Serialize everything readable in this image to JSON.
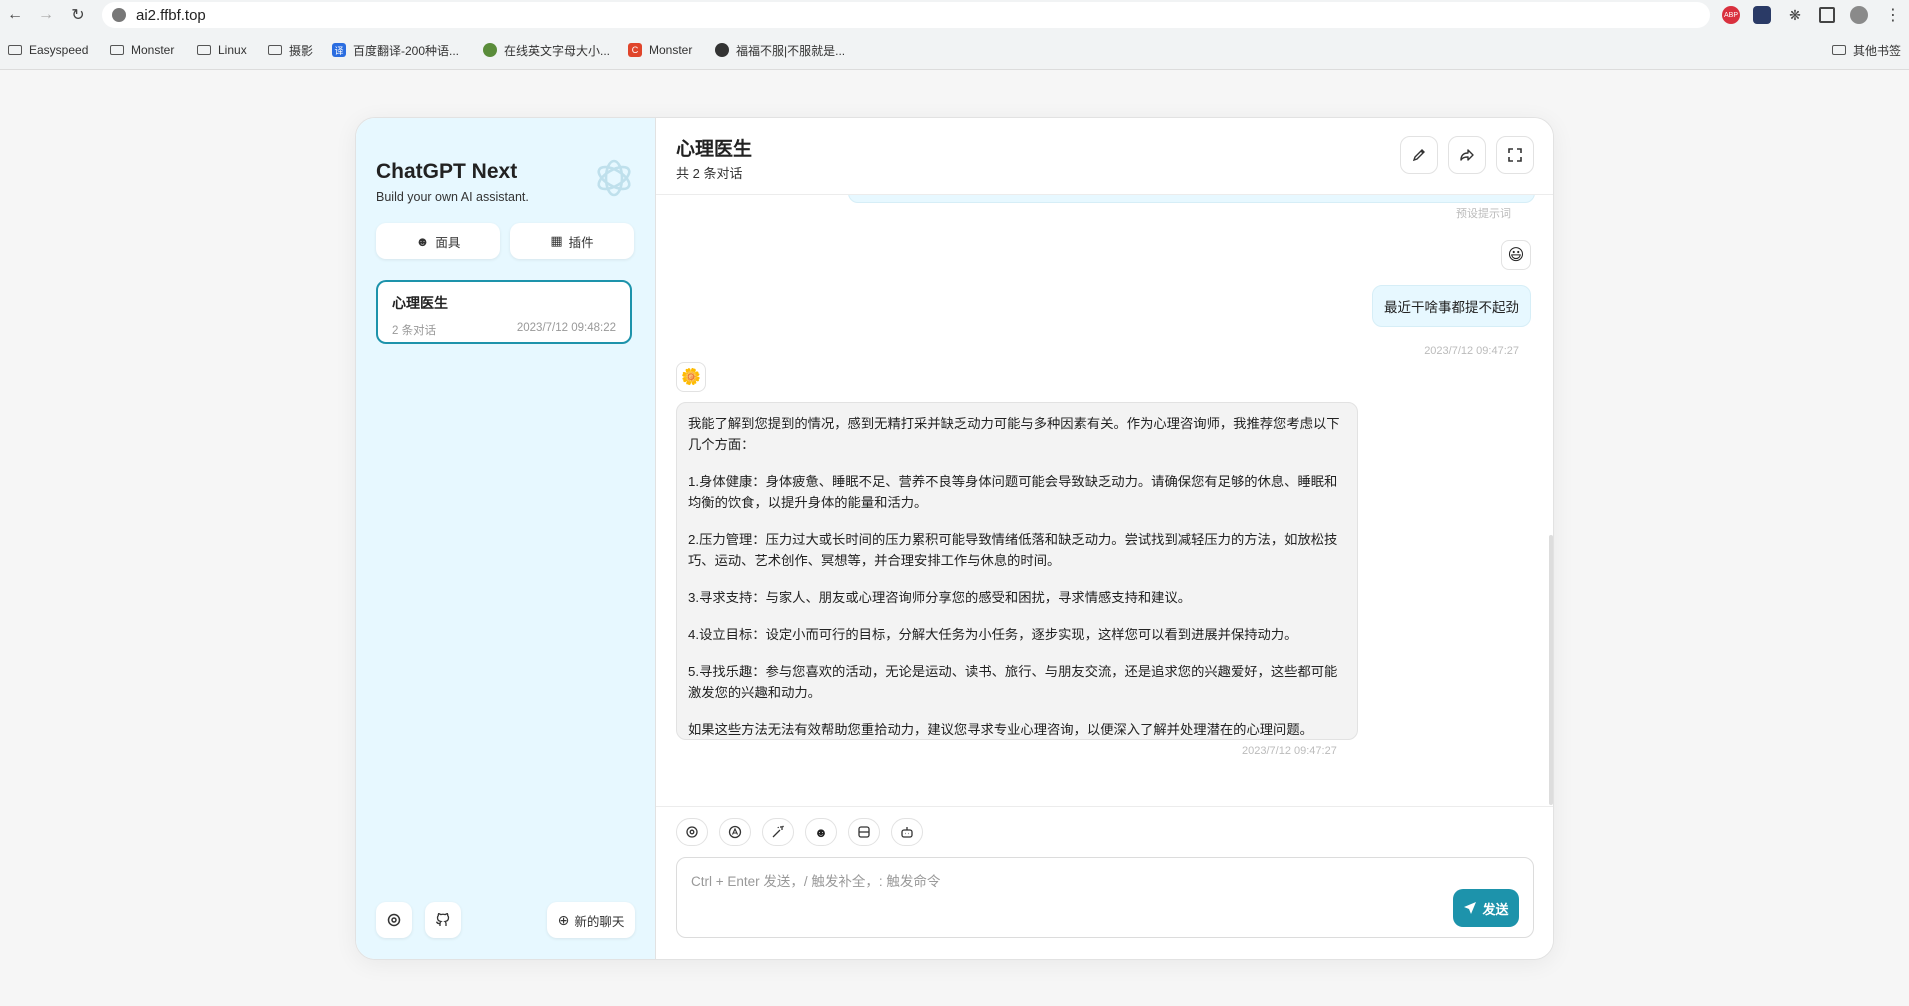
{
  "browser": {
    "url": "ai2.ffbf.top",
    "bookmarks": [
      "Easyspeed",
      "Monster",
      "Linux",
      "摄影",
      "百度翻译-200种语...",
      "在线英文字母大小...",
      "Monster",
      "福福不服|不服就是..."
    ],
    "other_bookmarks": "其他书签",
    "ext_badge": "ABP"
  },
  "sidebar": {
    "title": "ChatGPT Next",
    "subtitle": "Build your own AI assistant.",
    "mask_label": "面具",
    "plugin_label": "插件",
    "chats": [
      {
        "title": "心理医生",
        "count": "2 条对话",
        "date": "2023/7/12 09:48:22"
      }
    ],
    "new_chat_label": "新的聊天"
  },
  "header": {
    "title": "心理医生",
    "subtitle": "共 2 条对话"
  },
  "messages": {
    "preset_label": "预设提示词",
    "user": {
      "avatar": "😃",
      "text": "最近干啥事都提不起劲",
      "time": "2023/7/12 09:47:27"
    },
    "bot": {
      "avatar": "🌼",
      "paragraphs": [
        "我能了解到您提到的情况，感到无精打采并缺乏动力可能与多种因素有关。作为心理咨询师，我推荐您考虑以下几个方面：",
        "1.身体健康：身体疲惫、睡眠不足、营养不良等身体问题可能会导致缺乏动力。请确保您有足够的休息、睡眠和均衡的饮食，以提升身体的能量和活力。",
        "2.压力管理：压力过大或长时间的压力累积可能导致情绪低落和缺乏动力。尝试找到减轻压力的方法，如放松技巧、运动、艺术创作、冥想等，并合理安排工作与休息的时间。",
        "3.寻求支持：与家人、朋友或心理咨询师分享您的感受和困扰，寻求情感支持和建议。",
        "4.设立目标：设定小而可行的目标，分解大任务为小任务，逐步实现，这样您可以看到进展并保持动力。",
        "5.寻找乐趣：参与您喜欢的活动，无论是运动、读书、旅行、与朋友交流，还是追求您的兴趣爱好，这些都可能激发您的兴趣和动力。",
        "如果这些方法无法有效帮助您重拾动力，建议您寻求专业心理咨询，以便深入了解并处理潜在的心理问题。"
      ],
      "time": "2023/7/12 09:47:27"
    }
  },
  "input": {
    "placeholder": "Ctrl + Enter 发送，/ 触发补全，: 触发命令",
    "send_label": "发送"
  },
  "colors": {
    "accent": "#1d93ab",
    "sidebar_bg": "#e7f8ff"
  }
}
